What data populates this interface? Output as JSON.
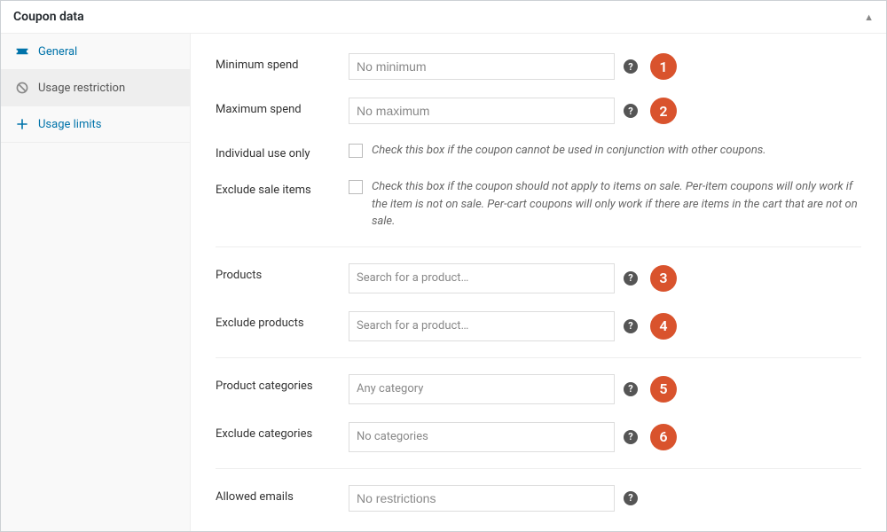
{
  "panel": {
    "title": "Coupon data"
  },
  "tabs": {
    "general": "General",
    "restriction": "Usage restriction",
    "limits": "Usage limits"
  },
  "fields": {
    "min_spend": {
      "label": "Minimum spend",
      "placeholder": "No minimum"
    },
    "max_spend": {
      "label": "Maximum spend",
      "placeholder": "No maximum"
    },
    "individual": {
      "label": "Individual use only",
      "desc": "Check this box if the coupon cannot be used in conjunction with other coupons."
    },
    "exclude_sale": {
      "label": "Exclude sale items",
      "desc": "Check this box if the coupon should not apply to items on sale. Per-item coupons will only work if the item is not on sale. Per-cart coupons will only work if there are items in the cart that are not on sale."
    },
    "products": {
      "label": "Products",
      "placeholder": "Search for a product…"
    },
    "exclude_products": {
      "label": "Exclude products",
      "placeholder": "Search for a product…"
    },
    "categories": {
      "label": "Product categories",
      "placeholder": "Any category"
    },
    "exclude_categories": {
      "label": "Exclude categories",
      "placeholder": "No categories"
    },
    "allowed_emails": {
      "label": "Allowed emails",
      "placeholder": "No restrictions"
    }
  },
  "callouts": {
    "c1": "1",
    "c2": "2",
    "c3": "3",
    "c4": "4",
    "c5": "5",
    "c6": "6"
  }
}
